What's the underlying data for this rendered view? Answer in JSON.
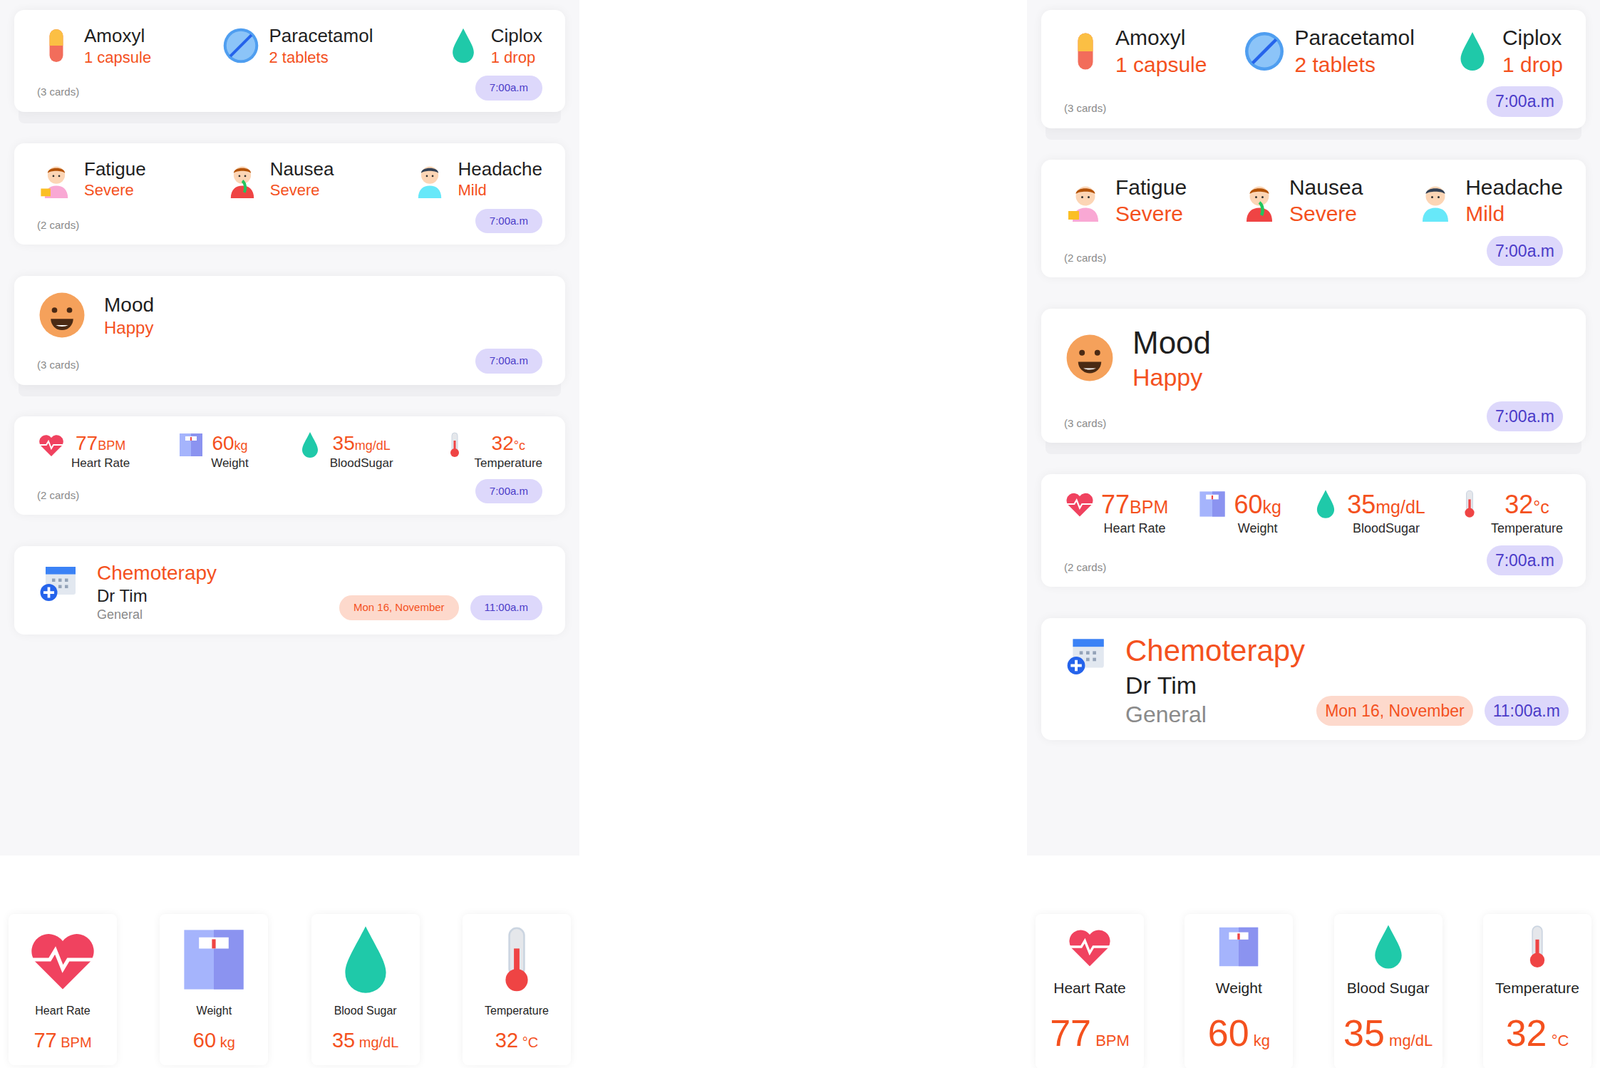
{
  "panels": [
    {
      "kind": "compact",
      "medications": {
        "items": [
          {
            "name": "Amoxyl",
            "dose": "1 capsule"
          },
          {
            "name": "Paracetamol",
            "dose": "2 tablets"
          },
          {
            "name": "Ciplox",
            "dose": "1 drop"
          }
        ],
        "count": "(3 cards)",
        "time": "7:00a.m",
        "stacked": true
      },
      "symptoms": {
        "items": [
          {
            "name": "Fatigue",
            "severity": "Severe"
          },
          {
            "name": "Nausea",
            "severity": "Severe"
          },
          {
            "name": "Headache",
            "severity": "Mild"
          }
        ],
        "count": "(2 cards)",
        "time": "7:00a.m",
        "stacked": false
      },
      "mood": {
        "label": "Mood",
        "value": "Happy",
        "count": "(3 cards)",
        "time": "7:00a.m",
        "stacked": true
      },
      "vitals": {
        "items": [
          {
            "value": "77",
            "unit": "BPM",
            "label": "Heart Rate"
          },
          {
            "value": "60",
            "unit": "kg",
            "label": "Weight"
          },
          {
            "value": "35",
            "unit": "mg/dL",
            "label": "BloodSugar"
          },
          {
            "value": "32",
            "unit": "°c",
            "label": "Temperature"
          }
        ],
        "count": "(2 cards)",
        "time": "7:00a.m",
        "stacked": false
      },
      "appointment": {
        "title": "Chemoterapy",
        "doctor": "Dr Tim",
        "specialty": "General",
        "date": "Mon 16, November",
        "time": "11:00a.m"
      },
      "tiles": [
        {
          "label": "Heart Rate",
          "value": "77",
          "unit": "BPM"
        },
        {
          "label": "Weight",
          "value": "60",
          "unit": "kg"
        },
        {
          "label": "Blood Sugar",
          "value": "35",
          "unit": "mg/dL"
        },
        {
          "label": "Temperature",
          "value": "32",
          "unit": "°C"
        }
      ]
    },
    {
      "kind": "expanded",
      "medications": {
        "items": [
          {
            "name": "Amoxyl",
            "dose": "1 capsule"
          },
          {
            "name": "Paracetamol",
            "dose": "2 tablets"
          },
          {
            "name": "Ciplox",
            "dose": "1 drop"
          }
        ],
        "count": "(3 cards)",
        "time": "7:00a.m",
        "stacked": true
      },
      "symptoms": {
        "items": [
          {
            "name": "Fatigue",
            "severity": "Severe"
          },
          {
            "name": "Nausea",
            "severity": "Severe"
          },
          {
            "name": "Headache",
            "severity": "Mild"
          }
        ],
        "count": "(2 cards)",
        "time": "7:00a.m",
        "stacked": false
      },
      "mood": {
        "label": "Mood",
        "value": "Happy",
        "count": "(3 cards)",
        "time": "7:00a.m",
        "stacked": true
      },
      "vitals": {
        "items": [
          {
            "value": "77",
            "unit": "BPM",
            "label": "Heart Rate"
          },
          {
            "value": "60",
            "unit": "kg",
            "label": "Weight"
          },
          {
            "value": "35",
            "unit": "mg/dL",
            "label": "BloodSugar"
          },
          {
            "value": "32",
            "unit": "°c",
            "label": "Temperature"
          }
        ],
        "count": "(2 cards)",
        "time": "7:00a.m",
        "stacked": false
      },
      "appointment": {
        "title": "Chemoterapy",
        "doctor": "Dr Tim",
        "specialty": "General",
        "date": "Mon 16, November",
        "time": "11:00a.m"
      },
      "tiles": [
        {
          "label": "Heart Rate",
          "value": "77",
          "unit": "BPM"
        },
        {
          "label": "Weight",
          "value": "60",
          "unit": "kg"
        },
        {
          "label": "Blood Sugar",
          "value": "35",
          "unit": "mg/dL"
        },
        {
          "label": "Temperature",
          "value": "32",
          "unit": "°C"
        }
      ]
    }
  ]
}
